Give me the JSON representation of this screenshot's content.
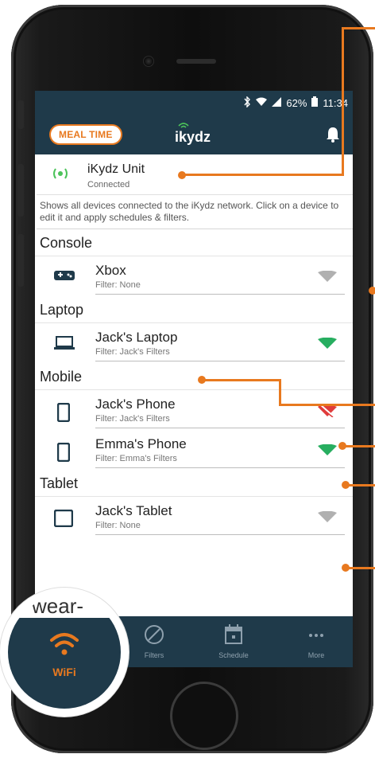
{
  "status_bar": {
    "icons": [
      "bluetooth-icon",
      "wifi-status-icon",
      "signal-icon"
    ],
    "battery": "62%",
    "time": "11:34"
  },
  "app_bar": {
    "meal_time_label": "MEAL TIME",
    "logo_text": "ikydz"
  },
  "unit": {
    "name": "iKydz Unit",
    "status": "Connected"
  },
  "description": "Shows all devices connected to the iKydz network. Click on a device to edit it and apply schedules & filters.",
  "sections": {
    "console": "Console",
    "laptop": "Laptop",
    "mobile": "Mobile",
    "tablet": "Tablet"
  },
  "devices": {
    "xbox": {
      "name": "Xbox",
      "filter": "Filter: None",
      "wifi": "grey"
    },
    "jacks_laptop": {
      "name": "Jack's Laptop",
      "filter": "Filter: Jack's Filters",
      "wifi": "green"
    },
    "jacks_phone": {
      "name": "Jack's Phone",
      "filter": "Filter: Jack's Filters",
      "wifi": "red-crossed"
    },
    "emmas_phone": {
      "name": "Emma's Phone",
      "filter": "Filter: Emma's Filters",
      "wifi": "green"
    },
    "jacks_tablet": {
      "name": "Jack's Tablet",
      "filter": "Filter: None",
      "wifi": "grey"
    }
  },
  "nav": {
    "wifi": "WiFi",
    "filters": "Filters",
    "schedule": "Schedule",
    "more": "More"
  },
  "zoom": {
    "partial_text": "wear-"
  },
  "colors": {
    "accent": "#e8791f",
    "header": "#1f3a4a",
    "wifi_green": "#27ae60",
    "wifi_grey": "#b0b0b0",
    "wifi_red": "#e03c3c"
  }
}
